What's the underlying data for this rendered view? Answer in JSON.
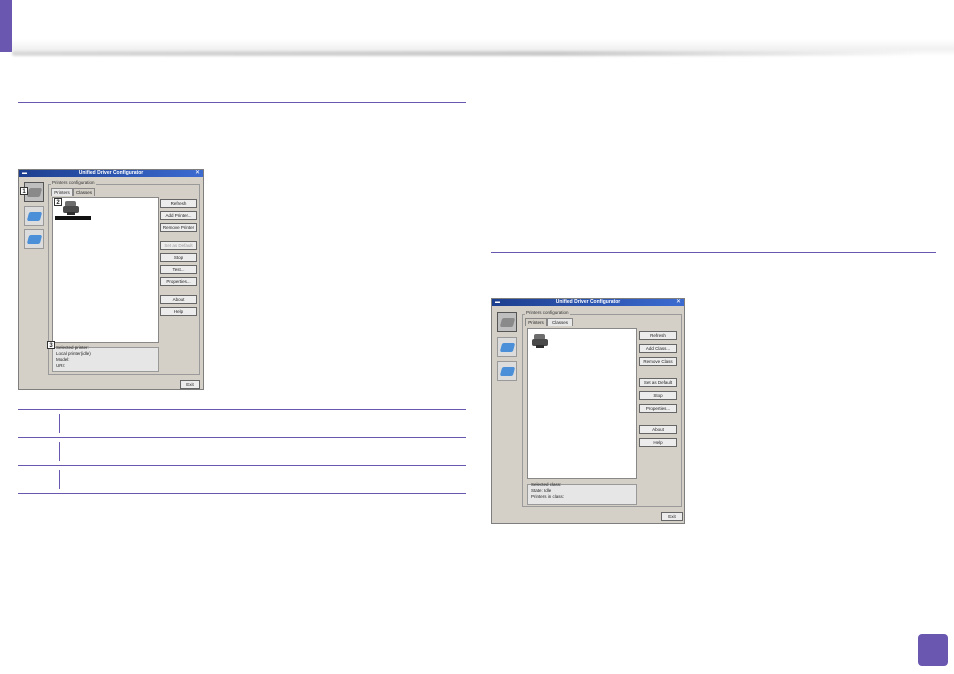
{
  "left_window": {
    "title": "Unified Driver Configurator",
    "group_label": "Printers configuration",
    "tabs": [
      "Printers",
      "Classes"
    ],
    "buttons": [
      "Refresh",
      "Add Printer...",
      "Remove Printer",
      "Set as Default",
      "Stop",
      "Test...",
      "Properties...",
      "About",
      "Help"
    ],
    "info_label": "Selected printer:",
    "info_lines": [
      "Local printer(idle)",
      "Model:",
      "URI:"
    ],
    "exit": "Exit",
    "callouts": [
      "1",
      "2",
      "3"
    ]
  },
  "right_window": {
    "title": "Unified Driver Configurator",
    "group_label": "Printers configuration",
    "tabs": [
      "Printers",
      "Classes"
    ],
    "buttons": [
      "Refresh",
      "Add Class...",
      "Remove Class",
      "Set as Default",
      "Stop",
      "Properties...",
      "About",
      "Help"
    ],
    "info_label": "Selected class:",
    "info_lines": [
      "State: Idle",
      "Printers in class:"
    ],
    "exit": "Exit"
  },
  "colors": {
    "accent": "#6a57b0",
    "titlebar": "#1d3f8f"
  }
}
